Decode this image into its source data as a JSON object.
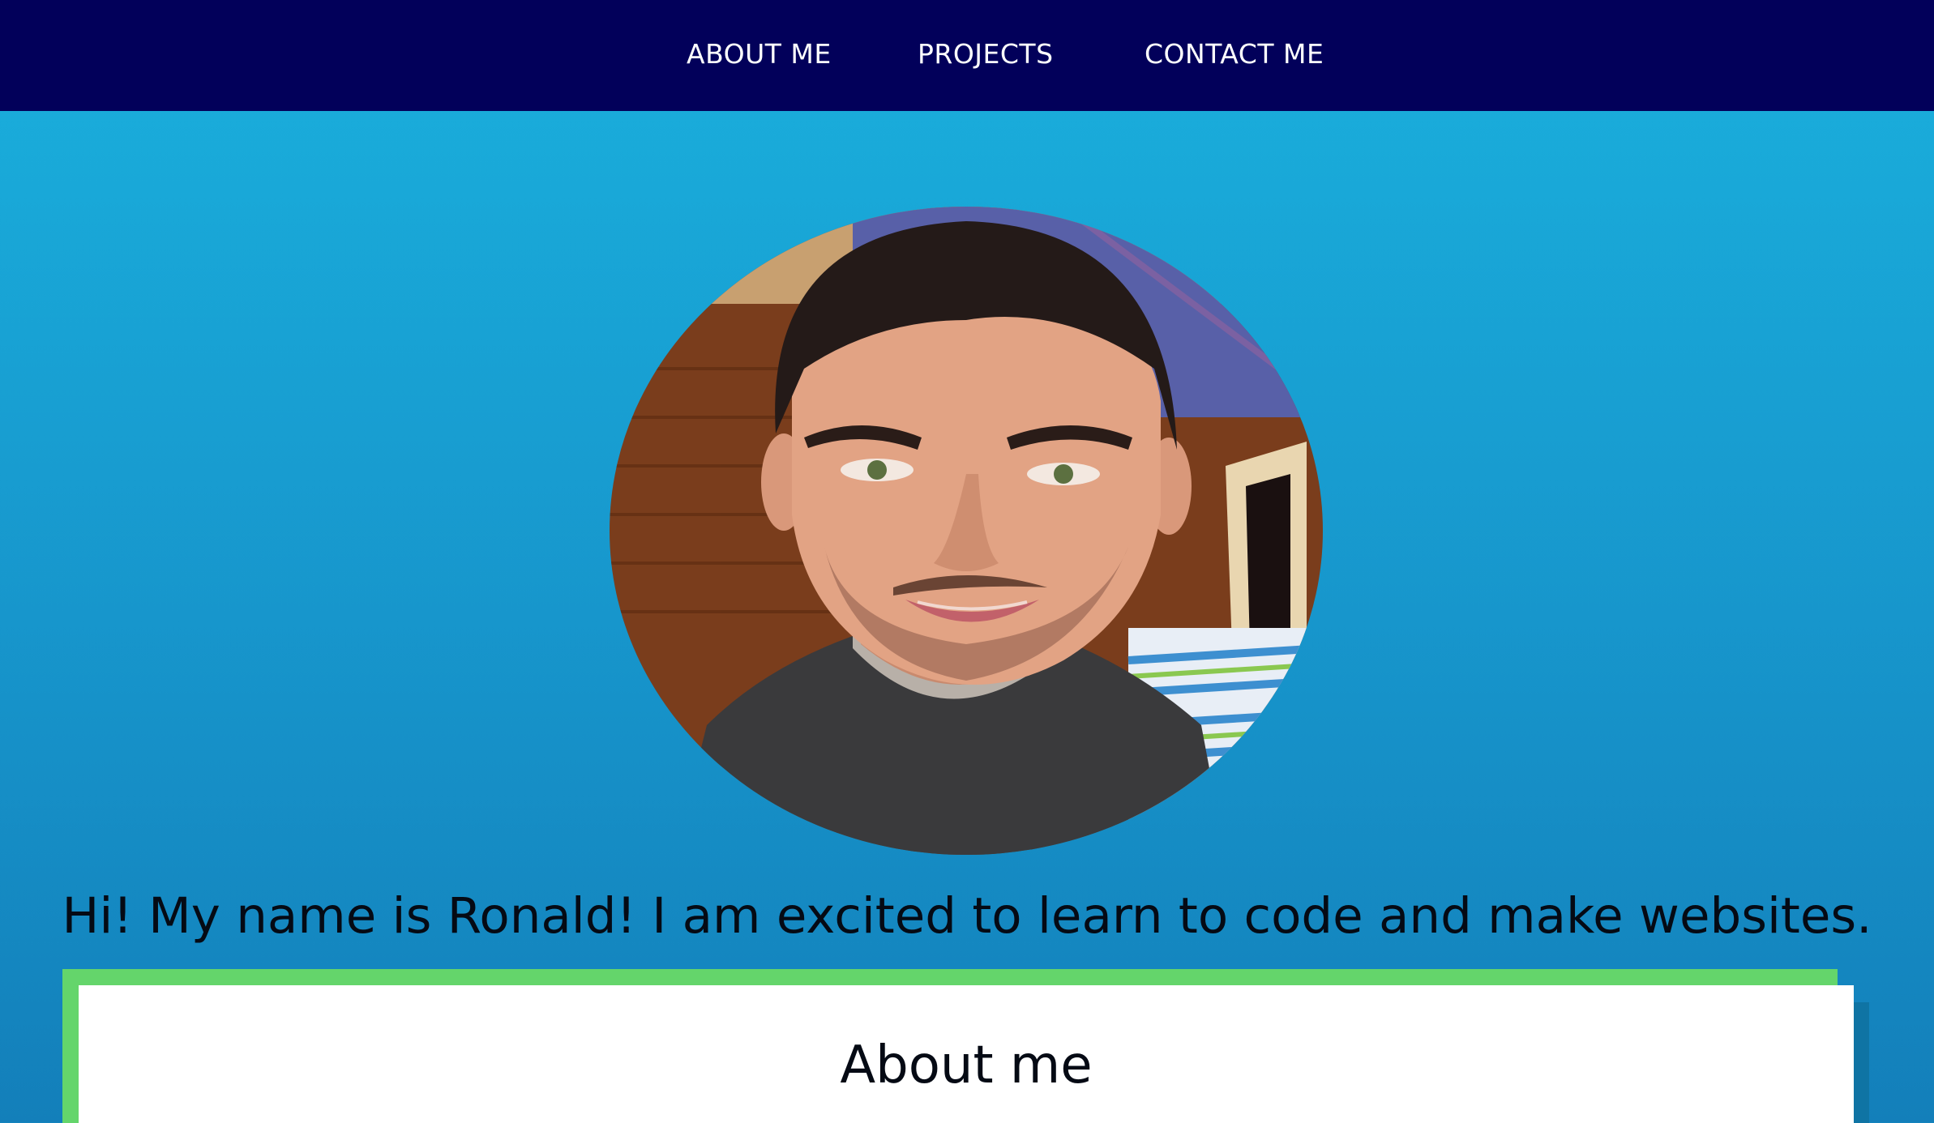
{
  "nav": {
    "items": [
      {
        "label": "ABOUT ME"
      },
      {
        "label": "PROJECTS"
      },
      {
        "label": "CONTACT ME"
      }
    ]
  },
  "hero": {
    "intro_text": "Hi! My name is Ronald! I am excited to learn to code and make websites."
  },
  "about": {
    "title": "About me"
  },
  "colors": {
    "nav_background": "#02005a",
    "page_gradient_top": "#1ab0dd",
    "page_gradient_bottom": "#137fba",
    "card_border": "#64d56b",
    "card_background": "#ffffff"
  }
}
